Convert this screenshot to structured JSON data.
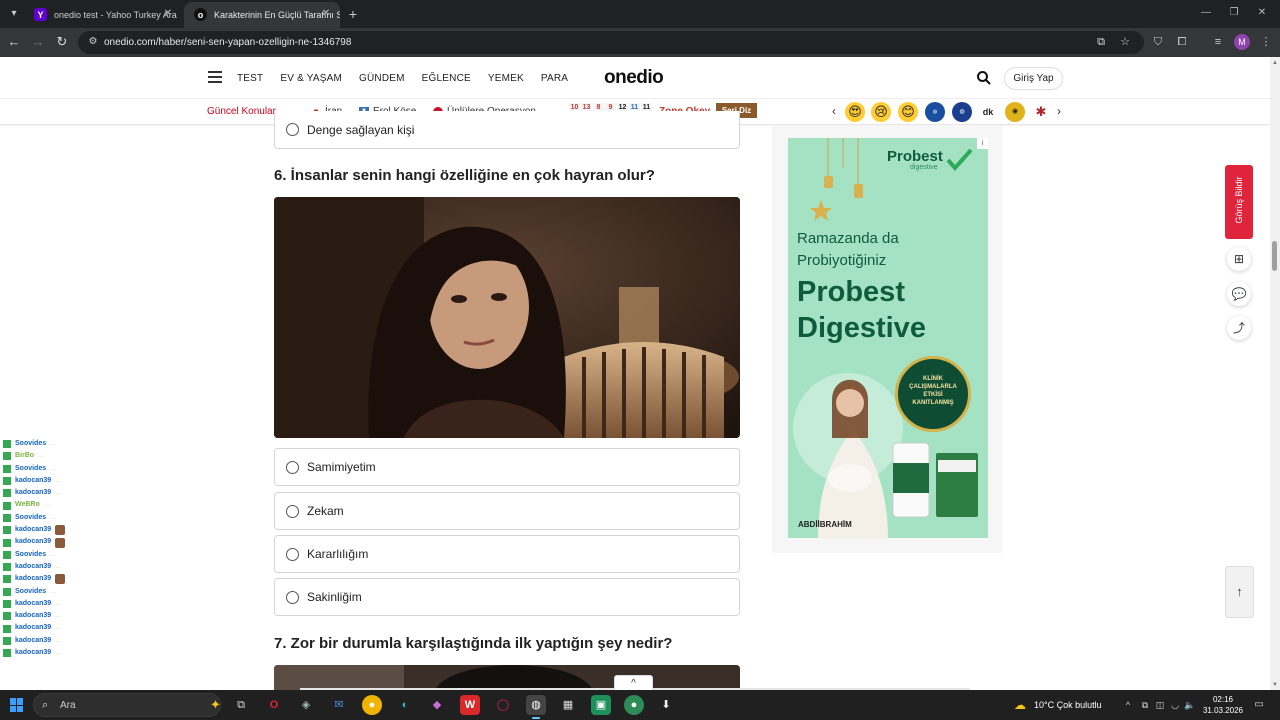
{
  "browser": {
    "tabs": [
      {
        "title": "onedio test - Yahoo Turkey Ara",
        "active": false
      },
      {
        "title": "Karakterinin En Güçlü Tarafını S",
        "active": true
      }
    ],
    "url": "onedio.com/haber/seni-sen-yapan-ozelligin-ne-1346798",
    "profile_initial": "M"
  },
  "site": {
    "nav": [
      "TEST",
      "EV & YAŞAM",
      "GÜNDEM",
      "EĞLENCE",
      "YEMEK",
      "PARA"
    ],
    "logo": "onedio",
    "login": "Giriş Yap",
    "topics_title": "Güncel Konular",
    "topics": [
      "İran",
      "Erol Köse",
      "Ünlülere Operasyon"
    ],
    "seri_numbers": [
      "10",
      "13",
      "8",
      "9",
      "12",
      "11",
      "11"
    ],
    "zone": "Zone Okey",
    "seri_diz": "Seri Diz"
  },
  "quiz": {
    "prev_option": "Denge sağlayan kişi",
    "question6": "6. İnsanlar senin hangi özelliğine en çok hayran olur?",
    "options6": [
      "Samimiyetim",
      "Zekam",
      "Kararlılığım",
      "Sakinliğim"
    ],
    "question7": "7. Zor bir durumla karşılaştığında ilk yaptığın şey nedir?"
  },
  "ad": {
    "brand": "Probest",
    "brand_sub": "digestive",
    "headline_1": "Ramazanda da",
    "headline_2": "Probiyotiğiniz",
    "product_1": "Probest",
    "product_2": "Digestive",
    "seal_text": "KLİNİK ÇALIŞMALARLA ETKİSİ KANITLANMIŞ",
    "maker": "ABDİİBRAHİM"
  },
  "feedback": "Görüş Bildir",
  "chat": [
    {
      "user": "Soovides",
      "color": "#1565c0",
      "msg": "..."
    },
    {
      "user": "BirBo",
      "color": "#7cb342",
      "msg": "..."
    },
    {
      "user": "Soovides",
      "color": "#1565c0",
      "msg": "..."
    },
    {
      "user": "kadocan39",
      "color": "#1565c0",
      "msg": "..."
    },
    {
      "user": "kadocan39",
      "color": "#1565c0",
      "msg": "..."
    },
    {
      "user": "WeBRo",
      "color": "#7cb342",
      "msg": "..."
    },
    {
      "user": "Soovides",
      "color": "#1565c0",
      "msg": "..."
    },
    {
      "user": "kadocan39",
      "color": "#1565c0",
      "msg": "",
      "emote": true
    },
    {
      "user": "kadocan39",
      "color": "#1565c0",
      "msg": "",
      "emote": true
    },
    {
      "user": "Soovides",
      "color": "#1565c0",
      "msg": "..."
    },
    {
      "user": "kadocan39",
      "color": "#1565c0",
      "msg": "..."
    },
    {
      "user": "kadocan39",
      "color": "#1565c0",
      "msg": "",
      "emote": true
    },
    {
      "user": "Soovides",
      "color": "#1565c0",
      "msg": "..."
    },
    {
      "user": "kadocan39",
      "color": "#1565c0",
      "msg": "..."
    },
    {
      "user": "kadocan39",
      "color": "#1565c0",
      "msg": "..."
    },
    {
      "user": "kadocan39",
      "color": "#1565c0",
      "msg": "..."
    },
    {
      "user": "kadocan39",
      "color": "#1565c0",
      "msg": "..."
    },
    {
      "user": "kadocan39",
      "color": "#1565c0",
      "msg": "..."
    }
  ],
  "taskbar": {
    "search_placeholder": "Ara",
    "weather": "10°C  Çok bulutlu",
    "time": "02:16",
    "date": "31.03.2026"
  }
}
